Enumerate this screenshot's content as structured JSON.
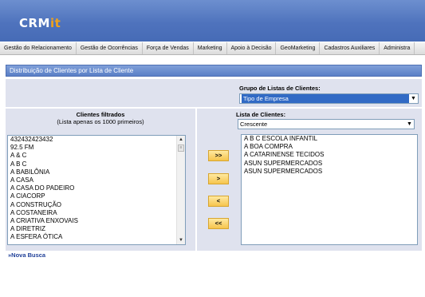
{
  "app": {
    "logo_text": "CRM",
    "logo_accent": "it"
  },
  "menu": [
    "Gestão do Relacionamento",
    "Gestão de Ocorrências",
    "Força de Vendas",
    "Marketing",
    "Apoio à Decisão",
    "GeoMarketing",
    "Cadastros Auxiliares",
    "Administra"
  ],
  "panel": {
    "title": "Distribuição de Clientes por Lista de Cliente",
    "group_label": "Grupo de Listas de Clientes:",
    "group_value": "Tipo de Empresa",
    "filtered_title": "Clientes filtrados",
    "filtered_sub": "(Lista apenas os 1000 primeiros)",
    "lista_label": "Lista de Clientes:",
    "lista_value": "Crescente",
    "filtered_clients": [
      "432432423432",
      "92.5 FM",
      "A & C",
      "A B C",
      "A BABILÔNIA",
      "A CASA",
      "A CASA DO PADEIRO",
      "A CIACORP",
      "A CONSTRUÇÃO",
      "A COSTANEIRA",
      "A CRIATIVA ENXOVAIS",
      "A DIRETRIZ",
      "A ESFERA ÓTICA"
    ],
    "list_clients": [
      "A B C ESCOLA INFANTIL",
      "A BOA COMPRA",
      "A CATARINENSE TECIDOS",
      "ASUN SUPERMERCADOS",
      "ASUN SUPERMERCADOS"
    ],
    "buttons": {
      "add_all": ">>",
      "add": ">",
      "remove": "<",
      "remove_all": "<<"
    }
  },
  "nova_busca": "»Nova Busca",
  "colors": {
    "header": "#5577c0",
    "accent": "#f0a21b",
    "panel_bg": "#dfe2ee",
    "button": "#f6c44c"
  }
}
